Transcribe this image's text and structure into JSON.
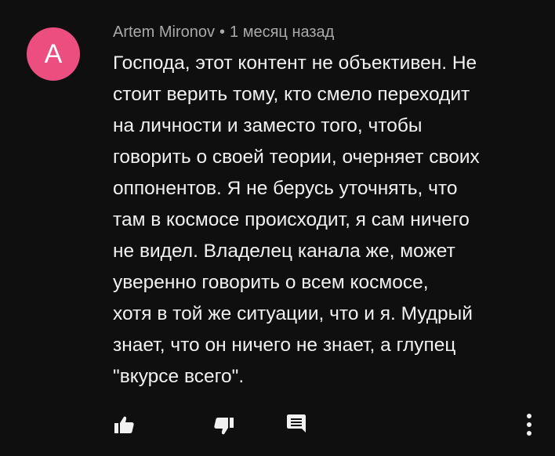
{
  "comment": {
    "avatar_letter": "A",
    "avatar_color": "#ec4f7f",
    "author": "Artem Mironov",
    "separator": "•",
    "timestamp": "1 месяц назад",
    "text": "Господа, этот контент не объективен. Не\nстоит верить тому, кто смело переходит\nна личности и заместо того, чтобы\nговорить о своей теории, очерняет своих\nоппонентов. Я не берусь уточнять, что\nтам в космосе происходит, я сам ничего\nне видел. Владелец канала же, может\nуверенно говорить о всем космосе,\nхотя в той же ситуации, что и я. Мудрый\nзнает, что он ничего не знает, а глупец\n\"вкурсе всего\"."
  },
  "actions": {
    "like_icon": "thumbs-up-icon",
    "dislike_icon": "thumbs-down-icon",
    "reply_icon": "comment-icon",
    "more_icon": "more-vertical-icon"
  },
  "colors": {
    "background": "#0f0f0f",
    "meta_text": "#aaaaaa",
    "body_text": "#f1f1f1",
    "icon": "#f1f1f1"
  }
}
